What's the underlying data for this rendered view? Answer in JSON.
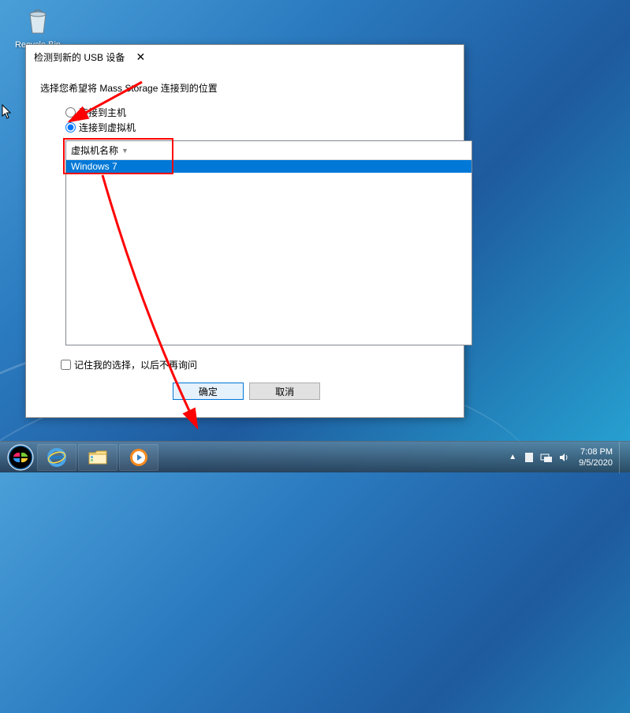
{
  "desktop": {
    "recycle_bin_label": "Recycle Bin"
  },
  "dialog": {
    "title": "检测到新的 USB 设备",
    "prompt": "选择您希望将 Mass Storage 连接到的位置",
    "radio_host": "连接到主机",
    "radio_vm": "连接到虚拟机",
    "vm_header": "虚拟机名称",
    "vm_rows": [
      {
        "name": "Windows 7"
      }
    ],
    "checkbox_label": "记住我的选择，以后不再询问",
    "ok_label": "确定",
    "cancel_label": "取消"
  },
  "taskbar": {
    "time": "7:08 PM",
    "date": "9/5/2020"
  }
}
